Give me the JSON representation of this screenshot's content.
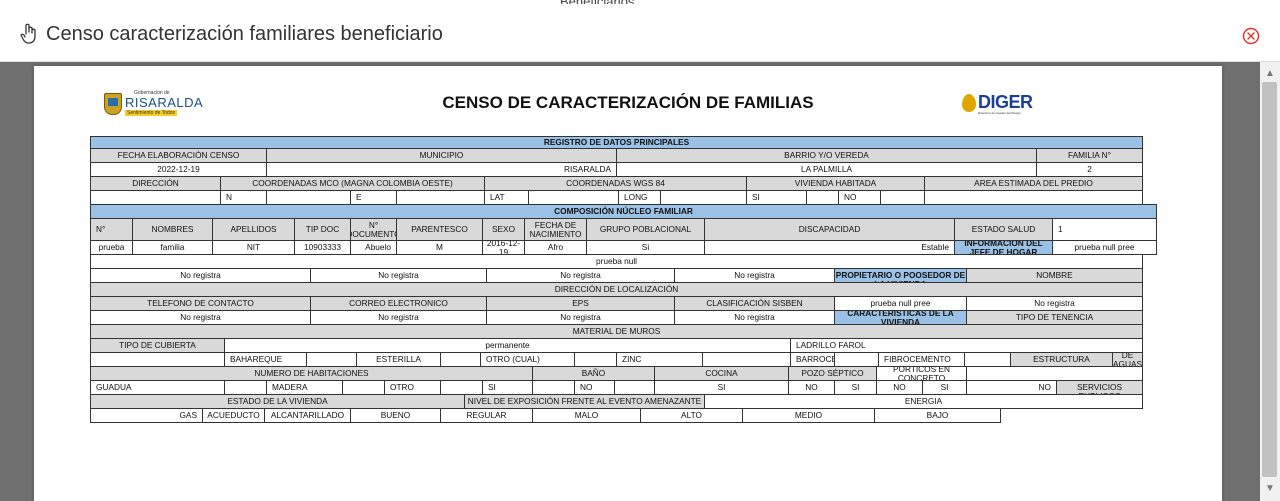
{
  "background": {
    "behind_text": "Beneficiarios"
  },
  "modal": {
    "title": "Censo caracterización familiares beneficiario",
    "icon": "hand-pointer-icon",
    "close_icon": "close-circle-icon"
  },
  "document": {
    "title": "CENSO DE CARACTERIZACIÓN DE FAMILIAS",
    "logo_left": {
      "small": "Gobernación de",
      "name": "RISARALDA",
      "tagline": "Sentimiento de Todos"
    },
    "logo_right": {
      "name": "DIGER",
      "sub": "Dirección de Gestión del Riesgo"
    }
  },
  "colors": {
    "section_header": "#9bc2e6",
    "label_row": "#d9d9d9"
  },
  "cells": [
    {
      "t": "REGISTRO DE DATOS PRINCIPALES",
      "s": "blue"
    },
    {
      "t": "FECHA ELABORACIÓN CENSO",
      "s": "gray"
    },
    {
      "t": "MUNICIPIO",
      "s": "gray"
    },
    {
      "t": "BARRIO Y/O VEREDA",
      "s": "gray"
    },
    {
      "t": "FAMILIA N°",
      "s": "gray"
    },
    {
      "t": "2022-12-19"
    },
    {
      "t": "RISARALDA",
      "a": "r"
    },
    {
      "t": "LA PALMILLA"
    },
    {
      "t": "2"
    },
    {
      "t": "DIRECCIÓN",
      "s": "gray"
    },
    {
      "t": "COORDENADAS MCO (MAGNA COLOMBIA OESTE)",
      "s": "gray"
    },
    {
      "t": "COORDENADAS WGS 84",
      "s": "gray"
    },
    {
      "t": "VIVIENDA HABITADA",
      "s": "gray"
    },
    {
      "t": "AREA ESTIMADA DEL PREDIO",
      "s": "gray"
    },
    {
      "t": ""
    },
    {
      "t": "N",
      "a": "l"
    },
    {
      "t": ""
    },
    {
      "t": "E",
      "a": "l"
    },
    {
      "t": ""
    },
    {
      "t": "LAT",
      "a": "l"
    },
    {
      "t": ""
    },
    {
      "t": "LONG",
      "a": "l"
    },
    {
      "t": ""
    },
    {
      "t": "SI",
      "a": "l"
    },
    {
      "t": ""
    },
    {
      "t": "NO",
      "a": "l"
    },
    {
      "t": ""
    },
    {
      "t": ""
    },
    {
      "t": "COMPOSICIÓN NÚCLEO FAMILIAR",
      "s": "blue"
    },
    {
      "t": "N°",
      "s": "gray",
      "a": "l"
    },
    {
      "t": "NOMBRES",
      "s": "gray"
    },
    {
      "t": "APELLIDOS",
      "s": "gray"
    },
    {
      "t": "TIP DOC",
      "s": "gray"
    },
    {
      "t": "N° DOCUMENTO",
      "s": "gray"
    },
    {
      "t": "PARENTESCO",
      "s": "gray"
    },
    {
      "t": "SEXO",
      "s": "gray"
    },
    {
      "t": "FECHA DE NACIMIENTO",
      "s": "gray"
    },
    {
      "t": "GRUPO POBLACIONAL",
      "s": "gray"
    },
    {
      "t": "DISCAPACIDAD",
      "s": "gray"
    },
    {
      "t": "ESTADO SALUD",
      "s": "gray"
    },
    {
      "t": "1",
      "a": "l"
    },
    {
      "t": "prueba"
    },
    {
      "t": "familia"
    },
    {
      "t": "NIT"
    },
    {
      "t": "10903333"
    },
    {
      "t": "Abuelo",
      "a": "r"
    },
    {
      "t": "M"
    },
    {
      "t": "2016-12-19"
    },
    {
      "t": "Afro"
    },
    {
      "t": "Si"
    },
    {
      "t": "Estable",
      "a": "r"
    },
    {
      "t": "INFORMACIÓN DEL JEFE DE HOGAR",
      "s": "blue"
    },
    {
      "t": "prueba null pree"
    },
    {
      "t": "prueba null"
    },
    {
      "t": "No registra"
    },
    {
      "t": "No registra"
    },
    {
      "t": "No registra"
    },
    {
      "t": "No registra"
    },
    {
      "t": "INFORMACIÓN DEL PROPIETARIO O POOSEDOR DE LA VIVIENDA",
      "s": "blue"
    },
    {
      "t": "NOMBRE",
      "s": "gray"
    },
    {
      "t": "DIRECCIÓN DE LOCALIZACIÓN",
      "s": "gray"
    },
    {
      "t": "TELEFONO DE CONTACTO",
      "s": "gray"
    },
    {
      "t": "CORREO ELECTRONICO",
      "s": "gray"
    },
    {
      "t": "EPS",
      "s": "gray"
    },
    {
      "t": "CLASIFICACIÓN SISBEN",
      "s": "gray"
    },
    {
      "t": "prueba null pree"
    },
    {
      "t": "No registra"
    },
    {
      "t": "No registra"
    },
    {
      "t": "No registra"
    },
    {
      "t": "No registra"
    },
    {
      "t": "No registra"
    },
    {
      "t": "CARACTERISTICAS DE LA VIVIENDA",
      "s": "blue"
    },
    {
      "t": "TIPO DE TENENCIA",
      "s": "gray"
    },
    {
      "t": "MATERIAL DE MUROS",
      "s": "gray"
    },
    {
      "t": "TIPO DE CUBIERTA",
      "s": "gray"
    },
    {
      "t": "permanente"
    },
    {
      "t": "LADRILLO FAROL",
      "a": "l"
    },
    {
      "t": ""
    },
    {
      "t": "BAHAREQUE",
      "a": "l"
    },
    {
      "t": ""
    },
    {
      "t": "ESTERILLA"
    },
    {
      "t": ""
    },
    {
      "t": "OTRO (CUAL)",
      "a": "l"
    },
    {
      "t": ""
    },
    {
      "t": "ZINC",
      "a": "l"
    },
    {
      "t": ""
    },
    {
      "t": "BARROCEMENTO",
      "a": "l"
    },
    {
      "t": ""
    },
    {
      "t": "FIBROCEMENTO",
      "a": "l"
    },
    {
      "t": ""
    },
    {
      "t": "ESTRUCTURA",
      "s": "gray"
    },
    {
      "t": "MANEJO DE AGUAS LLUVIAS",
      "s": "gray"
    },
    {
      "t": "NUMERO DE HABITACIONES",
      "s": "gray"
    },
    {
      "t": "BAÑO",
      "s": "gray"
    },
    {
      "t": "COCINA",
      "s": "gray"
    },
    {
      "t": "POZO SÉPTICO",
      "s": "gray"
    },
    {
      "t": "PÓRTICOS EN CONCRETO"
    },
    {
      "t": ""
    },
    {
      "t": "GUADUA",
      "a": "l"
    },
    {
      "t": ""
    },
    {
      "t": "MADERA",
      "a": "l"
    },
    {
      "t": ""
    },
    {
      "t": "OTRO",
      "a": "l"
    },
    {
      "t": ""
    },
    {
      "t": "SI",
      "a": "l"
    },
    {
      "t": ""
    },
    {
      "t": "NO",
      "a": "l"
    },
    {
      "t": ""
    },
    {
      "t": "SI"
    },
    {
      "t": "NO"
    },
    {
      "t": "SI"
    },
    {
      "t": "NO"
    },
    {
      "t": "SI"
    },
    {
      "t": "NO",
      "a": "r"
    },
    {
      "t": "DISPONIBILIDAD DE SERVICIOS PUBLICOS",
      "s": "gray"
    },
    {
      "t": "ESTADO DE LA VIVIENDA",
      "s": "gray"
    },
    {
      "t": "NIVEL DE EXPOSICIÓN FRENTE AL EVENTO AMENAZANTE",
      "s": "gray"
    },
    {
      "t": "ENERGIA"
    },
    {
      "t": "GAS",
      "a": "r"
    },
    {
      "t": "ACUEDUCTO"
    },
    {
      "t": "ALCANTARILLADO"
    },
    {
      "t": "BUENO"
    },
    {
      "t": "REGULAR"
    },
    {
      "t": "MALO"
    },
    {
      "t": "ALTO"
    },
    {
      "t": "MEDIO"
    },
    {
      "t": "BAJO"
    }
  ]
}
